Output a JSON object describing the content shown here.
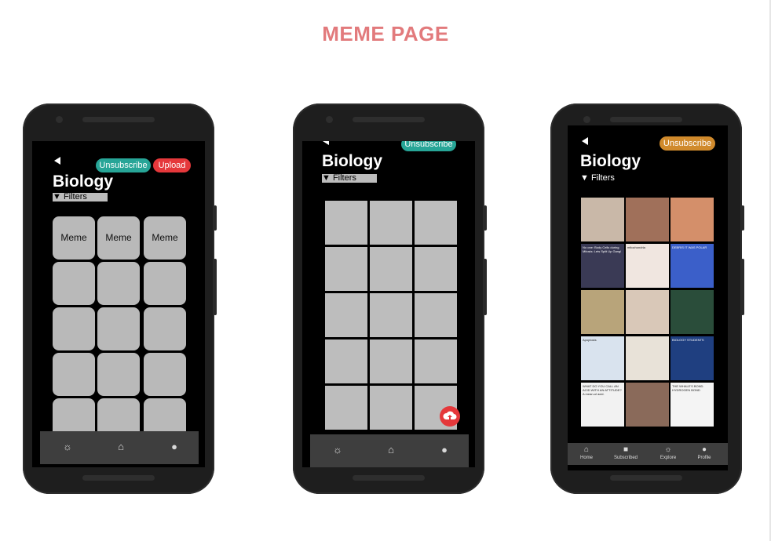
{
  "page_title": "MEME PAGE",
  "phone1": {
    "title": "Biology",
    "filters": "▼  Filters",
    "unsubscribe": "Unsubscribe",
    "upload": "Upload",
    "meme_label": "Meme"
  },
  "phone2": {
    "title": "Biology",
    "filters": "▼  Filters",
    "unsubscribe": "Unsubscribe"
  },
  "phone3": {
    "title": "Biology",
    "filters": "▼  Filters",
    "unsubscribe": "Unsubscribe",
    "nav": [
      "Home",
      "Subscribed",
      "Explore",
      "Profile"
    ],
    "meme_texts": [
      "",
      "",
      "",
      "No one:  Body Cells during Mitosis:  Lets Split Up Gang!",
      "mitochondria",
      "DEBRIS IT WAS POLAR",
      "",
      "",
      "",
      "Apoptosis",
      "",
      "BIOLOGY STUDENTS",
      "WHAT DO YOU CALL AN ACID WITH AN ATTITUDE? A mean-ol acid.",
      "",
      "THE WHALE'S BOND. HYDROGEN BOND"
    ]
  },
  "colors": {
    "title": "#e27a7c",
    "teal": "#27a597",
    "red": "#e5383b",
    "orange": "#d08a2c"
  },
  "icons": [
    "back-arrow-icon",
    "globe-icon",
    "home-icon",
    "user-icon",
    "upload-cloud-icon",
    "subscribed-icon"
  ]
}
